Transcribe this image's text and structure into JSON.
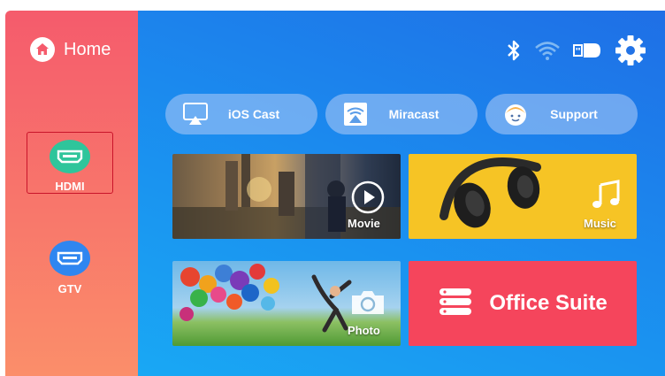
{
  "sidebar": {
    "home_label": "Home",
    "sources": [
      {
        "label": "HDMI",
        "color": "#2fc59b",
        "selected": true
      },
      {
        "label": "GTV",
        "color": "#2f86f0",
        "selected": false
      }
    ]
  },
  "status_icons": [
    "bluetooth-icon",
    "wifi-icon",
    "storage-icon",
    "gear-icon"
  ],
  "quick_actions": [
    {
      "label": "iOS Cast",
      "icon": "airplay-icon"
    },
    {
      "label": "Miracast",
      "icon": "miracast-icon"
    },
    {
      "label": "Support",
      "icon": "support-face-icon"
    }
  ],
  "tiles": {
    "movie": {
      "label": "Movie"
    },
    "music": {
      "label": "Music"
    },
    "photo": {
      "label": "Photo"
    },
    "office": {
      "label": "Office Suite"
    }
  },
  "colors": {
    "sidebar_top": "#f55b6c",
    "sidebar_bottom": "#fb8e6a",
    "main_top": "#1f6fe6",
    "main_bottom": "#19a8f4",
    "selected_border": "#c9142a",
    "hdmi": "#2fc59b",
    "gtv": "#2f86f0",
    "music_bg": "#f6c425",
    "office_bg": "#f5455c"
  }
}
